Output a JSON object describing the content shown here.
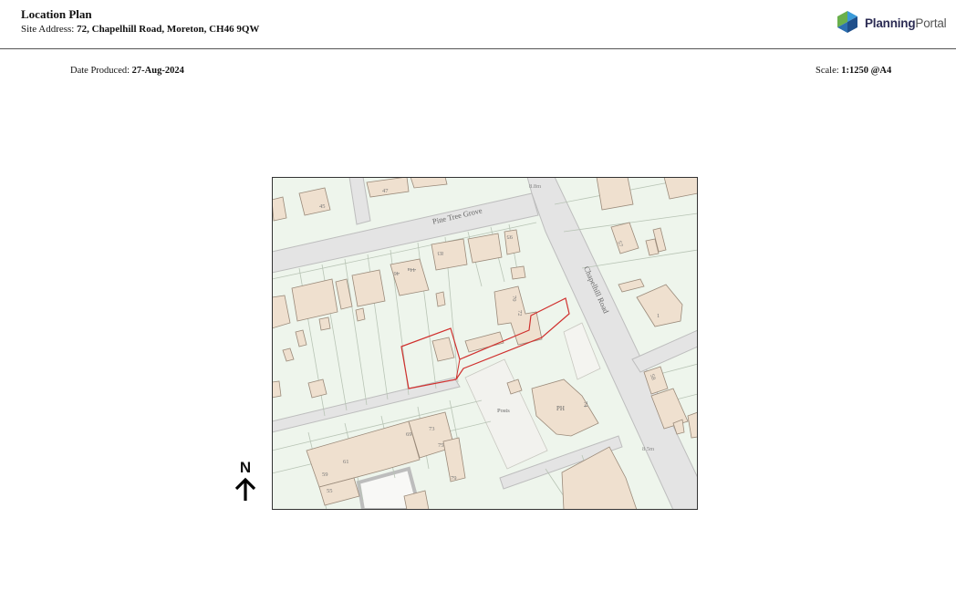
{
  "header": {
    "title": "Location Plan",
    "site_address_label": "Site Address: ",
    "site_address_value": "72, Chapelhill Road, Moreton, CH46 9QW"
  },
  "logo": {
    "text_bold": "Planning",
    "text_light": "Portal",
    "icon": "planning-portal-logo-icon"
  },
  "meta": {
    "date_label": "Date Produced: ",
    "date_value": "27-Aug-2024",
    "scale_label": "Scale: ",
    "scale_value": "1:1250 @A4"
  },
  "map": {
    "roads": [
      "Pine Tree Grove",
      "Chapelhill Road"
    ],
    "spot_heights": [
      "8.8m",
      "8.5m"
    ],
    "house_numbers": [
      "45",
      "47",
      "95",
      "83",
      "44a",
      "46",
      "70",
      "72",
      "57",
      "1",
      "74",
      "59",
      "61",
      "69",
      "73",
      "75",
      "79",
      "55",
      "58"
    ],
    "building_labels": [
      "PH",
      "Posts"
    ],
    "colors": {
      "building": "#efe0cf",
      "building_outline": "#9a8a7a",
      "plot": "#eef5ec",
      "road": "#e6e6e6",
      "road_edge": "#bdbdbd",
      "site_boundary": "#d0302e"
    }
  },
  "north_arrow": {
    "label": "N",
    "icon": "north-arrow-icon"
  }
}
